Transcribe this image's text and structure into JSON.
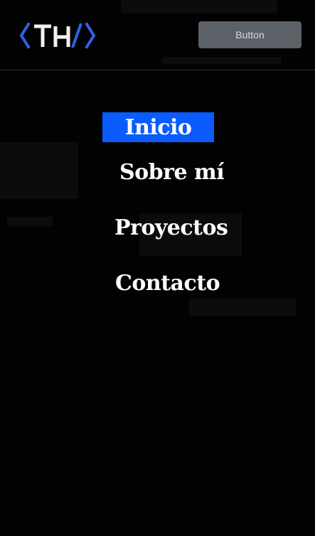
{
  "header": {
    "logo_text": "</TH/>",
    "button_label": "Button"
  },
  "menu": {
    "items": [
      {
        "label": "Inicio",
        "active": true
      },
      {
        "label": "Sobre mí",
        "active": false
      },
      {
        "label": "Proyectos",
        "active": false
      },
      {
        "label": "Contacto",
        "active": false
      }
    ]
  },
  "colors": {
    "background": "#020203",
    "accent": "#0a5cff",
    "button_bg": "#5c6067",
    "logo_bracket": "#2f63e3",
    "logo_letters": "#f2f2f2",
    "divider": "#2b2d31"
  }
}
